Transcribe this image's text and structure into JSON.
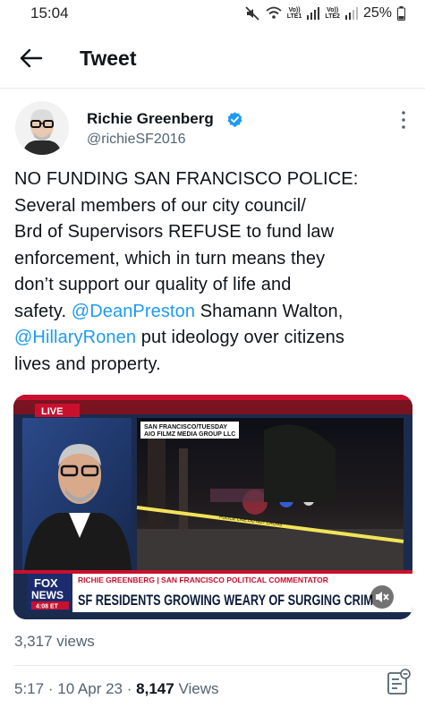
{
  "status_bar": {
    "time": "15:04",
    "lte1": "LTE1",
    "lte2": "LTE2",
    "volte": "Vo))",
    "battery": "25%"
  },
  "header": {
    "title": "Tweet",
    "back_icon": "back-arrow-icon"
  },
  "tweet": {
    "author_name": "Richie Greenberg",
    "author_handle": "@richieSF2016",
    "text_lines": [
      {
        "segments": [
          {
            "t": "NO FUNDING SAN FRANCISCO POLICE:"
          }
        ]
      },
      {
        "segments": [
          {
            "t": "Several members of our city council/"
          }
        ]
      },
      {
        "segments": [
          {
            "t": "Brd of Supervisors REFUSE to fund law"
          }
        ]
      },
      {
        "segments": [
          {
            "t": "enforcement, which in turn means they"
          }
        ]
      },
      {
        "segments": [
          {
            "t": "don’t support our quality of life and"
          }
        ]
      },
      {
        "segments": [
          {
            "t": "safety. "
          },
          {
            "t": "@DeanPreston",
            "mention": true
          },
          {
            "t": " Shamann Walton,"
          }
        ]
      },
      {
        "segments": [
          {
            "t": "@HillaryRonen",
            "mention": true
          },
          {
            "t": " put ideology over citizens"
          }
        ]
      },
      {
        "segments": [
          {
            "t": "lives and property."
          }
        ]
      }
    ],
    "media": {
      "live_badge": "LIVE",
      "dateline_1": "SAN FRANCISCO/TUESDAY",
      "dateline_2": "AIO FILMZ MEDIA GROUP LLC",
      "lower_third_name": "RICHIE GREENBERG | SAN FRANCISCO POLITICAL COMMENTATOR",
      "headline": "SF RESIDENTS GROWING WEARY OF SURGING CRIM",
      "network_1": "FOX",
      "network_2": "NEWS",
      "clock": "4:08 ET",
      "tape_text": "POLICE LINE DO NOT CROSS"
    },
    "views_count": "3,317 views",
    "time": "5:17",
    "date": "10 Apr 23",
    "views_num": "8,147",
    "views_label": "Views",
    "separator": "·"
  },
  "colors": {
    "accent": "#1d9bf0",
    "text_primary": "#0f1419",
    "text_secondary": "#536471",
    "divider": "#e6e9eb",
    "fox_red": "#c8102e",
    "fox_blue": "#1b2b4e"
  },
  "icons": {
    "mute": "mute-icon",
    "wifi": "wifi-icon",
    "signal": "signal-icon",
    "battery": "battery-icon",
    "verified": "verified-badge-icon",
    "more": "more-options-icon",
    "volume": "volume-muted-icon",
    "analytics": "analytics-icon"
  }
}
